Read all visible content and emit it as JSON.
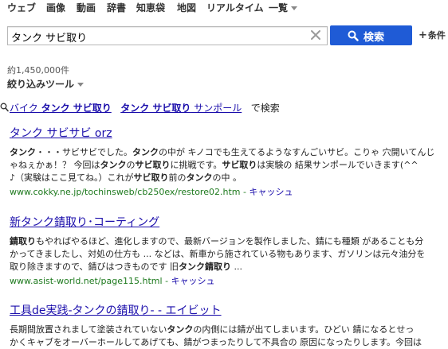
{
  "nav": {
    "items": [
      "ウェブ",
      "画像",
      "動画",
      "辞書",
      "知恵袋",
      "地図",
      "リアルタイム",
      "一覧"
    ]
  },
  "search": {
    "query": "タンク サビ取り",
    "button_label": "検索",
    "conditions_label": "条件"
  },
  "result_count": "約1,450,000件",
  "filter_label": "絞り込みツール",
  "related": {
    "item1": {
      "prefix": "バイク ",
      "bold": "タンク サビ取り"
    },
    "item2": {
      "bold": "タンク サビ取り",
      "suffix": " サンポール"
    },
    "search_suffix": "で検索"
  },
  "results": [
    {
      "title": "タンク サビサビ orz",
      "desc1": [
        {
          "t": "タンク",
          "b": true
        },
        {
          "t": "・・・サビサビでした。",
          "b": false
        },
        {
          "t": "タンク",
          "b": true
        },
        {
          "t": "の中が キノコでも生えてるようなすんごいサビ。こりゃ 穴開いてんじ",
          "b": false
        }
      ],
      "desc2": [
        {
          "t": "ゃねぇかぁ！？ 今回は",
          "b": false
        },
        {
          "t": "タンク",
          "b": true
        },
        {
          "t": "の",
          "b": false
        },
        {
          "t": "サビ取り",
          "b": true
        },
        {
          "t": "に挑戦です。",
          "b": false
        },
        {
          "t": "サビ取り",
          "b": true
        },
        {
          "t": "は実験の 結果サンポールでいきます(^^",
          "b": false
        }
      ],
      "desc3": [
        {
          "t": "♪（実験はここ見てね。）これが",
          "b": false
        },
        {
          "t": "サビ取り",
          "b": true
        },
        {
          "t": "前の",
          "b": false
        },
        {
          "t": "タンク",
          "b": true
        },
        {
          "t": "の中 。",
          "b": false
        }
      ],
      "url": "www.cokky.ne.jp/tochinsweb/cb250ex/restore02.htm",
      "cache": "キャッシュ"
    },
    {
      "title": "新タンク錆取り･コーティング",
      "desc1": [
        {
          "t": "錆取り",
          "b": true
        },
        {
          "t": "もやればやるほど、進化しますので、最新バージョンを製作しました、錆にも種類 があることも分",
          "b": false
        }
      ],
      "desc2": [
        {
          "t": "かってきましたし、対処の仕方も ... などは、新車から施されている物もあります、ガソリンは元々油分を",
          "b": false
        }
      ],
      "desc3": [
        {
          "t": "取り除きますので、錆びはつきものです 旧",
          "b": false
        },
        {
          "t": "タンク錆取り",
          "b": true
        },
        {
          "t": " ...",
          "b": false
        }
      ],
      "url": "www.asist-world.net/page115.html",
      "cache": "キャッシュ"
    },
    {
      "title": "工具de実践-タンクの錆取り- - エイビット",
      "desc1": [
        {
          "t": "長期間放置されまして塗装されていない",
          "b": false
        },
        {
          "t": "タンク",
          "b": true
        },
        {
          "t": "の内側には錆が出てしまいます。ひどい 錆になるとせっ",
          "b": false
        }
      ],
      "desc2": [
        {
          "t": "かくキャブをオーバーホールしてあげても、錆がつまったりして不具合の 原因になったりします。今回は",
          "b": false
        }
      ],
      "url": "",
      "cache": ""
    }
  ],
  "colors": {
    "link": "#1a0dab",
    "url_green": "#1e7a1e",
    "search_button": "#1f5bd6"
  },
  "icons": {
    "clear": "close-icon",
    "search": "magnifier-icon",
    "plus": "plus-icon",
    "caret": "caret-down-icon"
  }
}
